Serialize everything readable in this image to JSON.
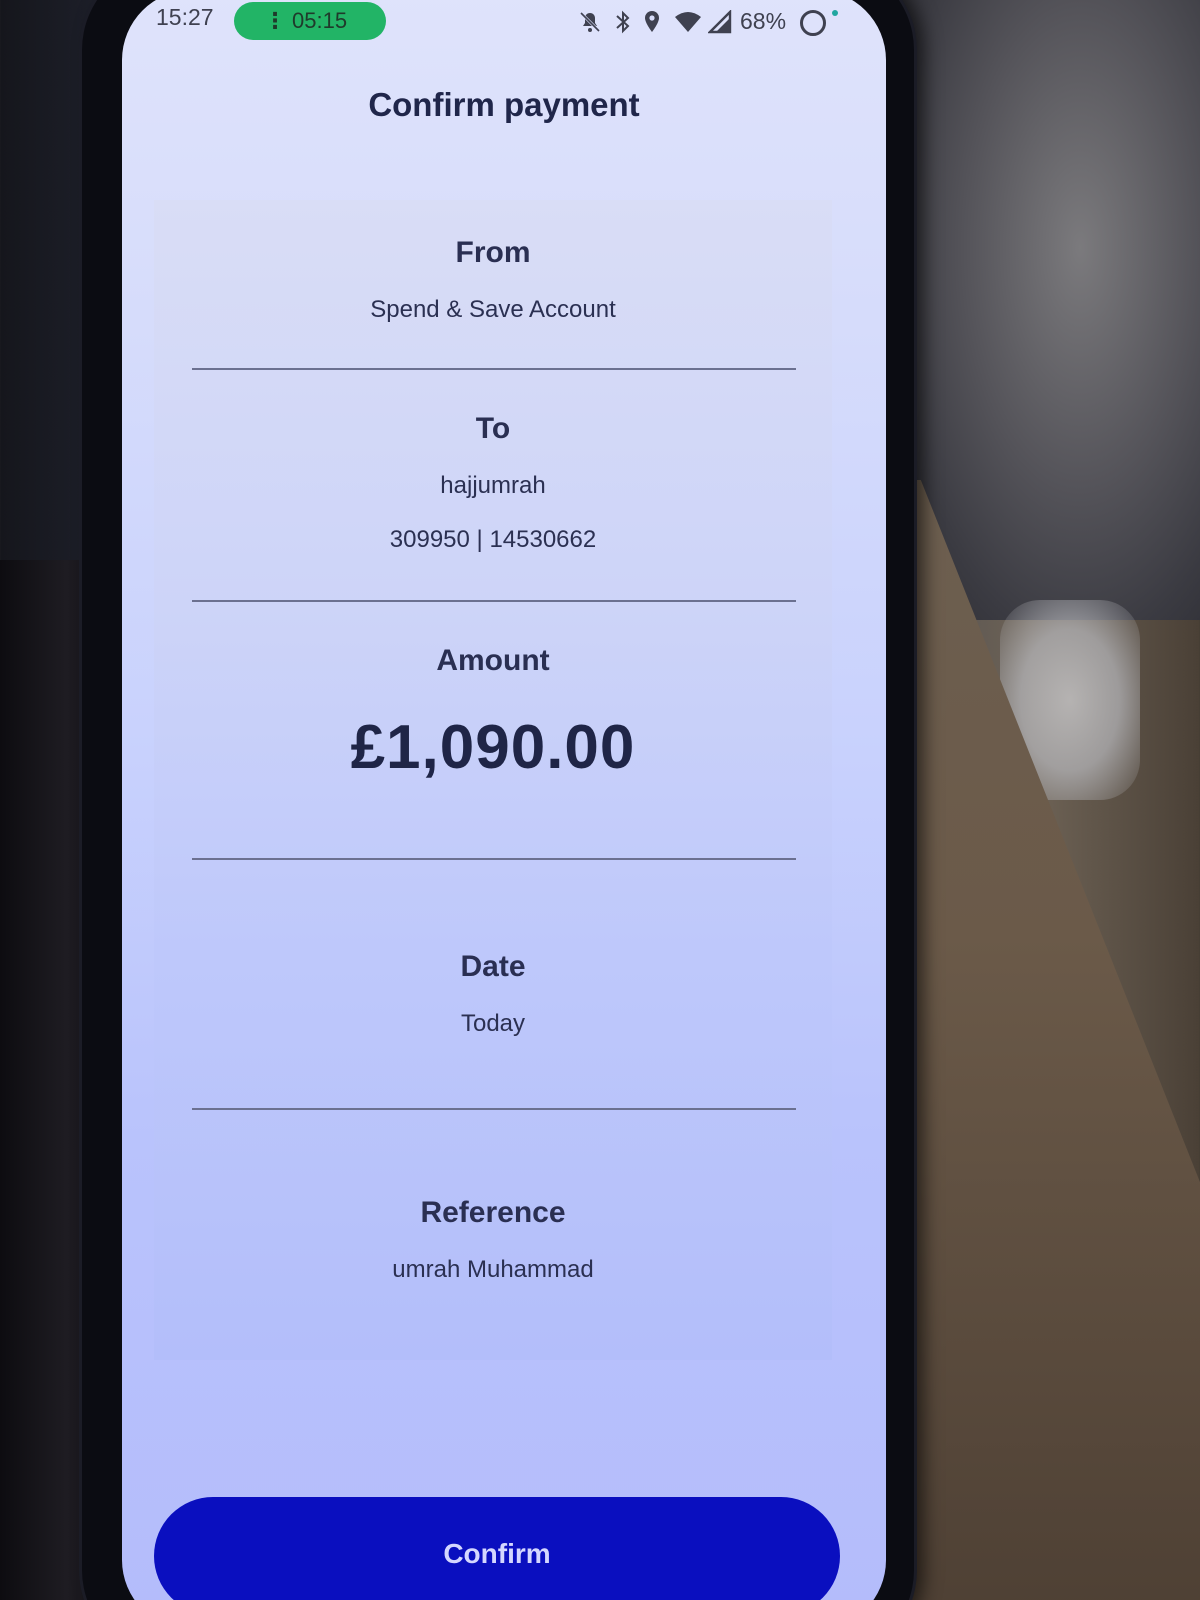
{
  "status_bar": {
    "time": "15:27",
    "call_timer": "05:15",
    "battery": "68%",
    "icons": [
      "call-icon",
      "mute-notifications-icon",
      "bluetooth-icon",
      "location-icon",
      "wifi-icon",
      "signal-icon",
      "ring-icon"
    ],
    "call_color": "#22b466"
  },
  "header": {
    "title": "Confirm payment"
  },
  "payment": {
    "from_label": "From",
    "from_value": "Spend & Save Account",
    "to_label": "To",
    "to_name": "hajjumrah",
    "to_account": "309950 | 14530662",
    "amount_label": "Amount",
    "amount_value": "£1,090.00",
    "date_label": "Date",
    "date_value": "Today",
    "reference_label": "Reference",
    "reference_value": "umrah Muhammad"
  },
  "actions": {
    "confirm_label": "Confirm",
    "confirm_color": "#0a0fbf"
  }
}
